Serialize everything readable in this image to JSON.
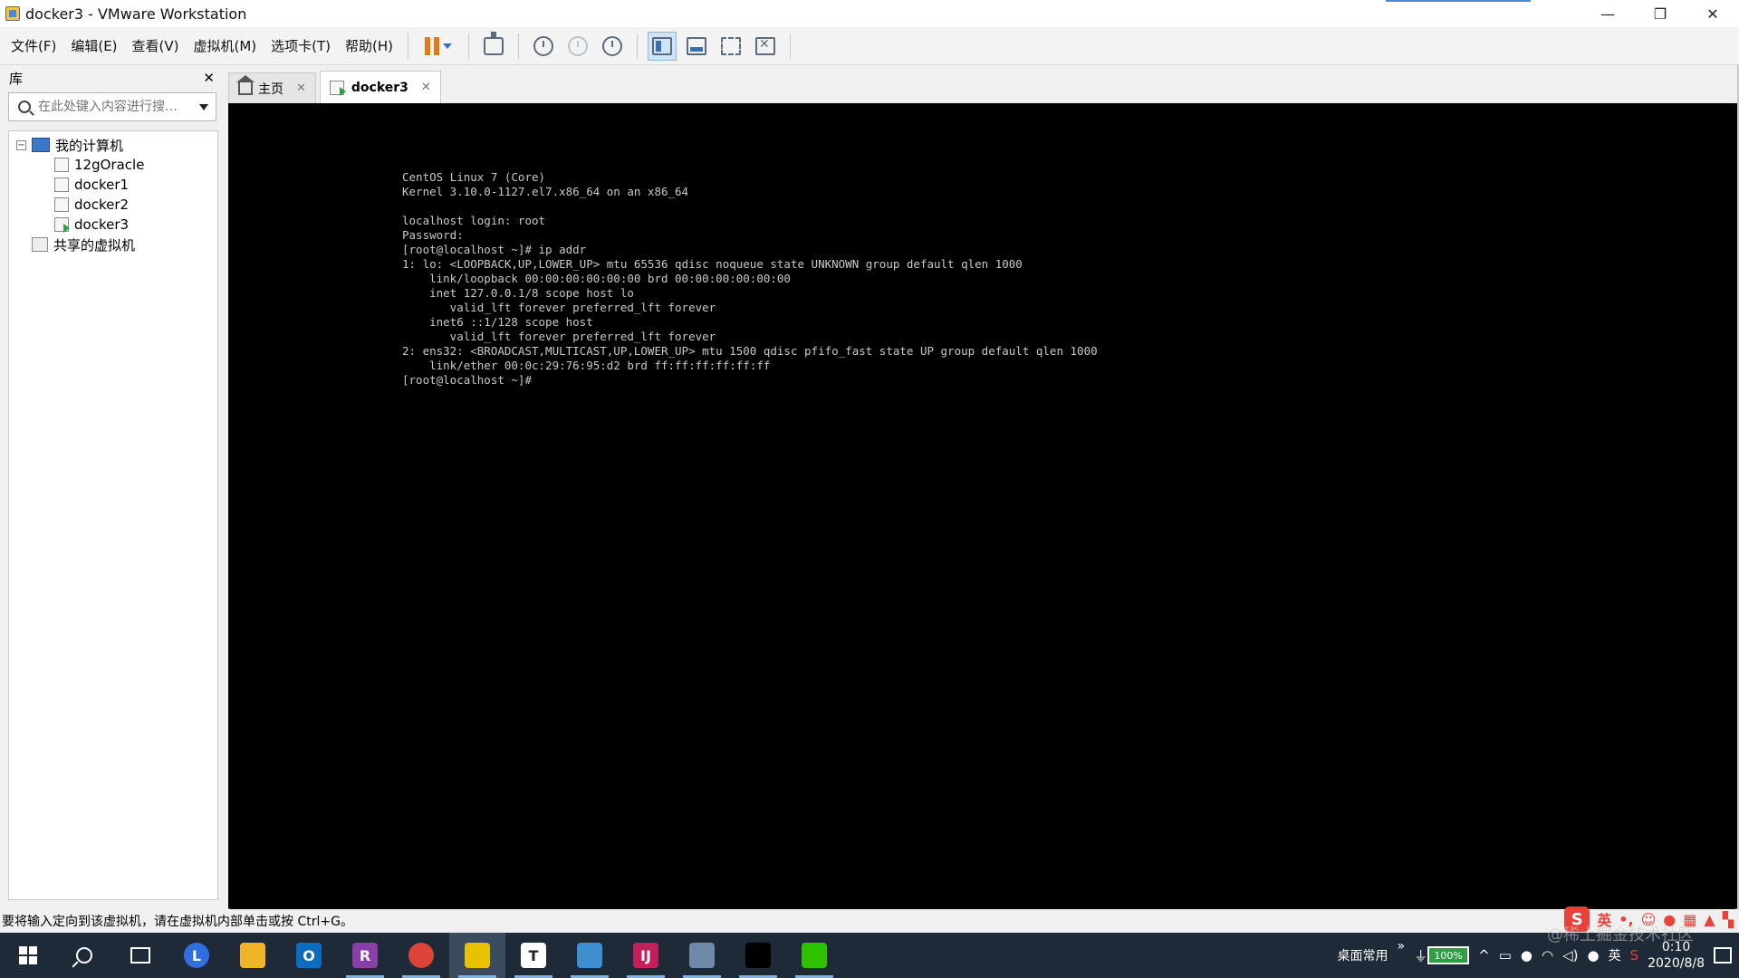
{
  "window": {
    "title": "docker3 - VMware Workstation",
    "controls": {
      "minimize": "—",
      "restore": "❐",
      "close": "✕"
    }
  },
  "menu": [
    "文件(F)",
    "编辑(E)",
    "查看(V)",
    "虚拟机(M)",
    "选项卡(T)",
    "帮助(H)"
  ],
  "toolbar": {
    "icons": [
      "pause-icon",
      "send-ctrl-alt-del-icon",
      "snapshot-icon",
      "revert-snapshot-icon",
      "snapshot-manager-icon",
      "library-view-icon",
      "thumbnail-bar-icon",
      "fullscreen-icon",
      "unity-icon",
      "console-view-icon"
    ]
  },
  "library": {
    "title": "库",
    "close": "✕",
    "search": {
      "placeholder": "在此处键入内容进行搜…",
      "value": ""
    },
    "tree": {
      "root": "我的计算机",
      "expander": "−",
      "vms": [
        {
          "name": "12gOracle",
          "running": false
        },
        {
          "name": "docker1",
          "running": false
        },
        {
          "name": "docker2",
          "running": false
        },
        {
          "name": "docker3",
          "running": true
        }
      ],
      "shared": "共享的虚拟机"
    }
  },
  "tabs": [
    {
      "label": "主页",
      "icon": "home-icon",
      "active": false,
      "close": "✕"
    },
    {
      "label": "docker3",
      "icon": "vm-running-icon",
      "active": true,
      "close": "✕"
    }
  ],
  "console": {
    "lines": [
      "CentOS Linux 7 (Core)",
      "Kernel 3.10.0-1127.el7.x86_64 on an x86_64",
      "",
      "localhost login: root",
      "Password:",
      "[root@localhost ~]# ip addr",
      "1: lo: <LOOPBACK,UP,LOWER_UP> mtu 65536 qdisc noqueue state UNKNOWN group default qlen 1000",
      "    link/loopback 00:00:00:00:00:00 brd 00:00:00:00:00:00",
      "    inet 127.0.0.1/8 scope host lo",
      "       valid_lft forever preferred_lft forever",
      "    inet6 ::1/128 scope host",
      "       valid_lft forever preferred_lft forever",
      "2: ens32: <BROADCAST,MULTICAST,UP,LOWER_UP> mtu 1500 qdisc pfifo_fast state UP group default qlen 1000",
      "    link/ether 00:0c:29:76:95:d2 brd ff:ff:ff:ff:ff:ff",
      "[root@localhost ~]#"
    ]
  },
  "status": {
    "text": "要将输入定向到该虚拟机，请在虚拟机内部单击或按 Ctrl+G。",
    "ime": {
      "logo": "S",
      "lang": "英"
    }
  },
  "taskbar": {
    "apps": [
      {
        "name": "lark",
        "label": "L",
        "color": "#2f6fe0"
      },
      {
        "name": "file-explorer",
        "label": "",
        "color": "#f0b429"
      },
      {
        "name": "outlook",
        "label": "O",
        "color": "#0f6cbd"
      },
      {
        "name": "winrar",
        "label": "R",
        "color": "#8a3ea8"
      },
      {
        "name": "chrome",
        "label": "",
        "color": "#db4437"
      },
      {
        "name": "notepad-yellow",
        "label": "",
        "color": "#e6c200"
      },
      {
        "name": "typora",
        "label": "T",
        "color": "#ffffff"
      },
      {
        "name": "vmware",
        "label": "",
        "color": "#3e8ed0"
      },
      {
        "name": "intellij",
        "label": "IJ",
        "color": "#c21f5b"
      },
      {
        "name": "image-viewer",
        "label": "",
        "color": "#6e8aa8"
      },
      {
        "name": "terminal",
        "label": "",
        "color": "#000000"
      },
      {
        "name": "wechat",
        "label": "",
        "color": "#2dc100"
      }
    ],
    "tray": {
      "desktop_label": "桌面常用",
      "more": "»",
      "battery": "100%",
      "lang": "英",
      "time": "0:10",
      "date": "2020/8/8"
    }
  },
  "watermark": "@稀土掘金技术社区"
}
